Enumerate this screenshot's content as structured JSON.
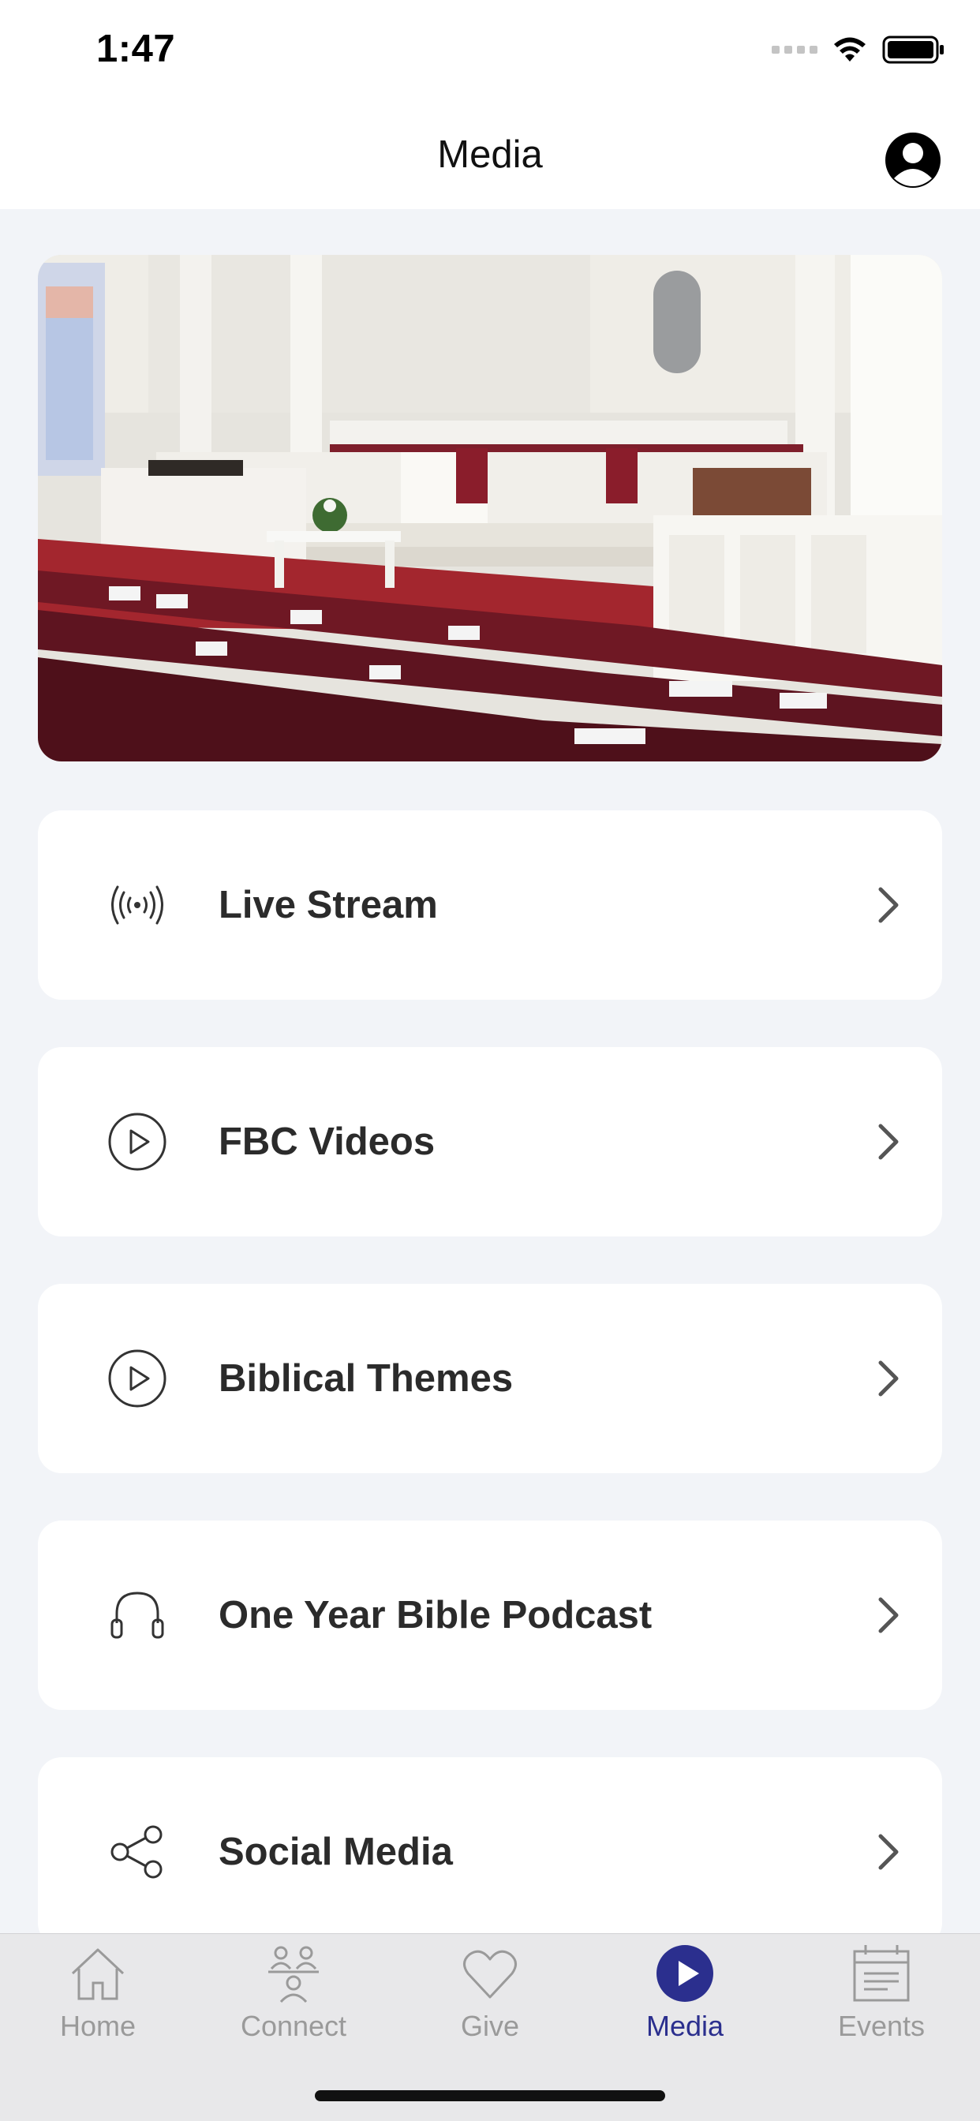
{
  "status_bar": {
    "time": "1:47"
  },
  "nav": {
    "title": "Media"
  },
  "menu": [
    {
      "label": "Live Stream",
      "icon": "broadcast-icon"
    },
    {
      "label": "FBC Videos",
      "icon": "play-circle-icon"
    },
    {
      "label": "Biblical Themes",
      "icon": "play-circle-icon"
    },
    {
      "label": "One Year Bible Podcast",
      "icon": "headphones-icon"
    },
    {
      "label": "Social Media",
      "icon": "share-icon"
    }
  ],
  "tabs": [
    {
      "label": "Home",
      "icon": "house-icon",
      "active": false
    },
    {
      "label": "Connect",
      "icon": "people-icon",
      "active": false
    },
    {
      "label": "Give",
      "icon": "heart-icon",
      "active": false
    },
    {
      "label": "Media",
      "icon": "play-circle-filled-icon",
      "active": true
    },
    {
      "label": "Events",
      "icon": "calendar-icon",
      "active": false
    }
  ],
  "colors": {
    "accent": "#2b2f8e",
    "background": "#f2f4f8",
    "card": "#ffffff",
    "tabbar": "#e8e8ea"
  }
}
